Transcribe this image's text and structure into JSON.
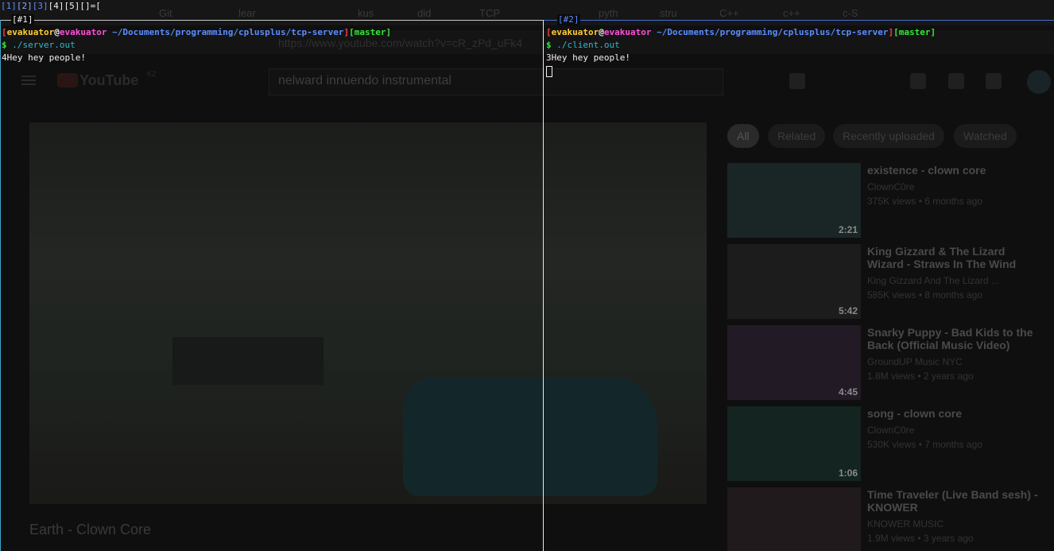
{
  "tmux": {
    "window_list": [
      "[1]",
      "[2]",
      "[3]",
      "[4]",
      "[5]",
      "[]=["
    ],
    "pane1_title": "[#1]",
    "pane2_title": "[#2]"
  },
  "pane1": {
    "user": "evakuator",
    "at": "@",
    "host": "evakuator",
    "path": "~/Documents/programming/cplusplus/tcp-server",
    "branch": "[master]",
    "lbracket": "[",
    "rbracket": "]",
    "prompt": "$",
    "command": "./server.out",
    "output": "4Hey hey people!"
  },
  "pane2": {
    "user": "evakuator",
    "at": "@",
    "host": "evakuator",
    "path": "~/Documents/programming/cplusplus/tcp-server",
    "branch": "[master]",
    "lbracket": "[",
    "rbracket": "]",
    "prompt": "$",
    "command": "./client.out",
    "output": "3Hey hey people!"
  },
  "background": {
    "tabs": [
      "Git",
      "lear",
      "kus",
      "did",
      "TCP",
      "pyth",
      "stru",
      "C++",
      "c++",
      "c-S"
    ],
    "url": "https://www.youtube.com/watch?v=cR_zPd_uFk4",
    "yt_logo_text": "YouTube",
    "yt_region": "KZ",
    "search_query": "nelward innuendo instrumental",
    "video_title": "Earth - Clown Core",
    "chips": [
      "All",
      "Related",
      "Recently uploaded",
      "Watched"
    ],
    "related": [
      {
        "title": "existence - clown core",
        "channel": "ClownC0re",
        "meta": "375K views • 6 months ago",
        "duration": "2:21"
      },
      {
        "title": "King Gizzard & The Lizard Wizard - Straws In The Wind",
        "channel": "King Gizzard And The Lizard ...",
        "meta": "585K views • 8 months ago",
        "duration": "5:42"
      },
      {
        "title": "Snarky Puppy - Bad Kids to the Back (Official Music Video)",
        "channel": "GroundUP Music NYC",
        "meta": "1.8M views • 2 years ago",
        "duration": "4:45"
      },
      {
        "title": "song - clown core",
        "channel": "ClownC0re",
        "meta": "530K views • 7 months ago",
        "duration": "1:06"
      },
      {
        "title": "Time Traveler (Live Band sesh) - KNOWER",
        "channel": "KNOWER MUSIC",
        "meta": "1.9M views • 3 years ago",
        "duration": ""
      }
    ]
  }
}
